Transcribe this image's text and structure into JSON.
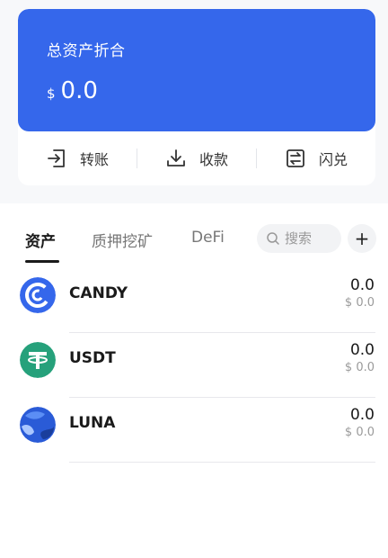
{
  "balance": {
    "label": "总资产折合",
    "currency": "$",
    "amount": "0.0"
  },
  "actions": [
    {
      "label": "转账",
      "icon": "transfer-icon"
    },
    {
      "label": "收款",
      "icon": "receive-icon"
    },
    {
      "label": "闪兑",
      "icon": "swap-icon"
    }
  ],
  "tabs": [
    {
      "label": "资产",
      "active": true
    },
    {
      "label": "质押挖矿",
      "active": false
    },
    {
      "label": "DeFi",
      "active": false
    }
  ],
  "search": {
    "placeholder": "搜索"
  },
  "add_label": "+",
  "assets": [
    {
      "name": "CANDY",
      "amount": "0.0",
      "usd": "$ 0.0",
      "icon": "candy-coin-icon",
      "color": "#3567eb"
    },
    {
      "name": "USDT",
      "amount": "0.0",
      "usd": "$ 0.0",
      "icon": "usdt-coin-icon",
      "color": "#26a17b"
    },
    {
      "name": "LUNA",
      "amount": "0.0",
      "usd": "$ 0.0",
      "icon": "luna-coin-icon",
      "color": "#2a5bd7"
    }
  ],
  "colors": {
    "accent": "#3567eb"
  }
}
